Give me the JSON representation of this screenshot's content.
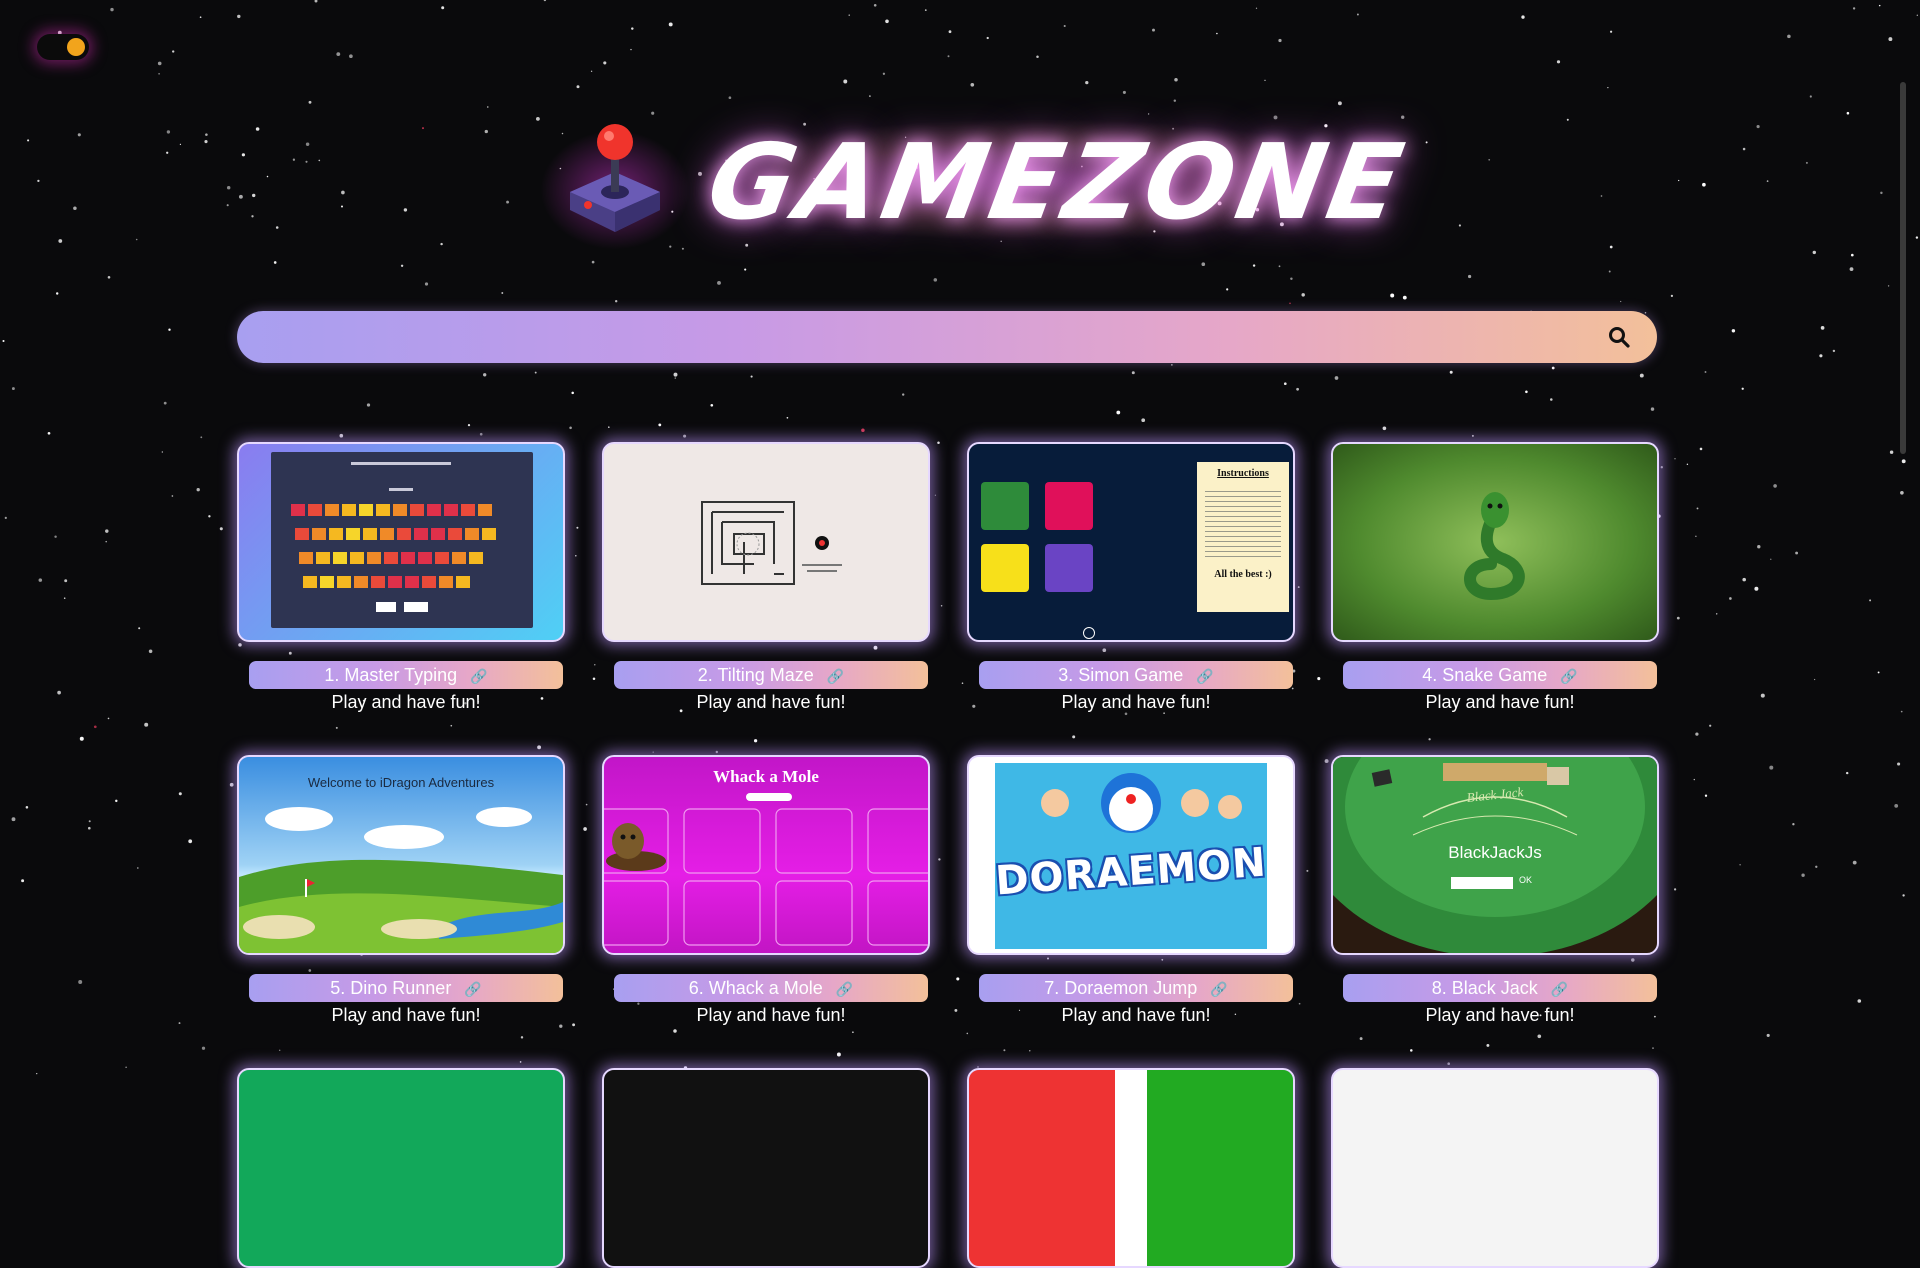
{
  "header": {
    "title": "GAMEZONE"
  },
  "search": {
    "placeholder": "",
    "value": ""
  },
  "colors": {
    "accent_start": "#a89ff0",
    "accent_end": "#f3c09a",
    "background": "#0a0a0c"
  },
  "cards": [
    {
      "number": "1.",
      "title": "Master Typing",
      "subtitle": "Play and have fun!",
      "link_icon": "link-icon"
    },
    {
      "number": "2.",
      "title": "Tilting Maze",
      "subtitle": "Play and have fun!",
      "link_icon": "link-icon"
    },
    {
      "number": "3.",
      "title": "Simon Game",
      "subtitle": "Play and have fun!",
      "link_icon": "link-icon"
    },
    {
      "number": "4.",
      "title": "Snake Game",
      "subtitle": "Play and have fun!",
      "link_icon": "link-icon"
    },
    {
      "number": "5.",
      "title": "Dino Runner",
      "subtitle": "Play and have fun!",
      "link_icon": "link-icon"
    },
    {
      "number": "6.",
      "title": "Whack a Mole",
      "subtitle": "Play and have fun!",
      "link_icon": "link-icon"
    },
    {
      "number": "7.",
      "title": "Doraemon Jump",
      "subtitle": "Play and have fun!",
      "link_icon": "link-icon"
    },
    {
      "number": "8.",
      "title": "Black Jack",
      "subtitle": "Play and have fun!",
      "link_icon": "link-icon"
    }
  ],
  "thumbs": {
    "dino": {
      "welcome": "Welcome to iDragon Adventures"
    },
    "mole": {
      "heading": "Whack a Mole"
    },
    "doraemon": {
      "logo": "DORAEMON"
    },
    "blackjack": {
      "title": "BlackJackJs",
      "ok": "OK",
      "table_text": "Black Jack"
    },
    "simon": {
      "instructions_title": "Instructions",
      "all_best": "All the best :)"
    }
  }
}
